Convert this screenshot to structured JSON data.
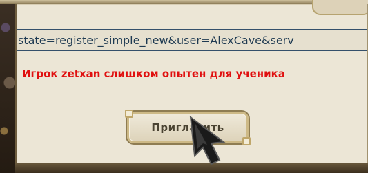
{
  "dialog": {
    "url_text": "state=register_simple_new&user=AlexCave&serv",
    "message": "Игрок zetxan слишком опытен для ученика",
    "invite_button_label": "Пригласить"
  },
  "colors": {
    "message": "#e01010",
    "url_text": "#1e3a52",
    "dialog_bg": "#ece6d6"
  },
  "icons": {
    "cursor": "arrow-cursor-icon"
  }
}
